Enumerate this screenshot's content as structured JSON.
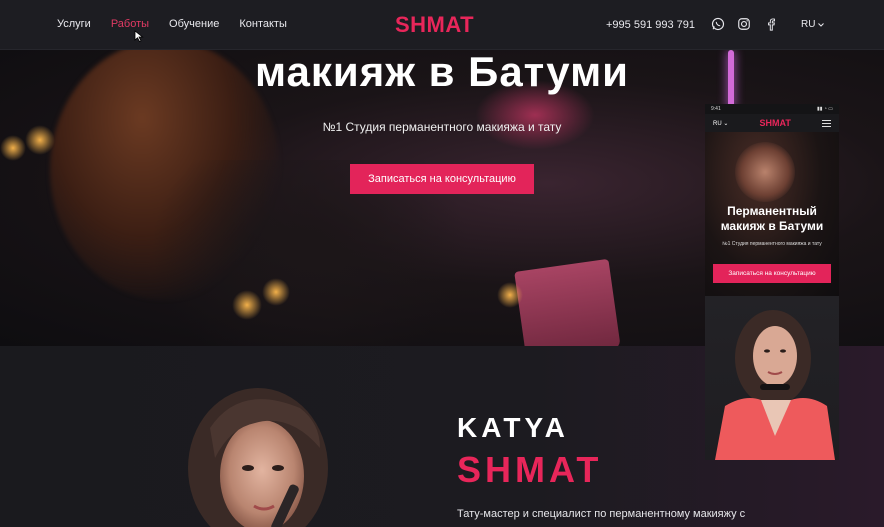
{
  "header": {
    "nav": [
      "Услуги",
      "Работы",
      "Обучение",
      "Контакты"
    ],
    "active_nav": "Работы",
    "logo": "SHMAT",
    "phone": "+995 591 993 791",
    "social_icons": [
      "whatsapp-icon",
      "instagram-icon",
      "facebook-icon"
    ],
    "language": "RU"
  },
  "hero": {
    "title": "макияж в Батуми",
    "subtitle": "№1 Студия перманентного макияжа и тату",
    "cta": "Записаться на консультацию"
  },
  "about": {
    "first_name": "KATYA",
    "last_name": "SHMAT",
    "text": "Тату-мастер и специалист по перманентному макияжу с"
  },
  "mobile_preview": {
    "time": "9:41",
    "language": "RU",
    "logo": "SHMAT",
    "title_line1": "Перманентный",
    "title_line2": "макияж в Батуми",
    "subtitle": "№1 Студия перманентного макияжа и тату",
    "cta": "Записаться на консультацию"
  },
  "colors": {
    "accent": "#e3245a",
    "header_bg": "#1d1d22",
    "page_bg": "#1b1b1f"
  }
}
